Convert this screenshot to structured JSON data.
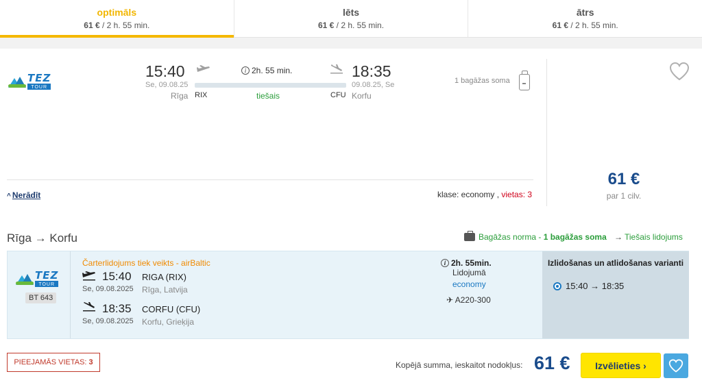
{
  "tabs": [
    {
      "title": "optimāls",
      "price": "61 €",
      "duration": " / 2 h. 55 min.",
      "active": true
    },
    {
      "title": "lēts",
      "price": "61 €",
      "duration": " / 2 h. 55 min.",
      "active": false
    },
    {
      "title": "ātrs",
      "price": "61 €",
      "duration": " / 2 h. 55 min.",
      "active": false
    }
  ],
  "summary": {
    "airline_logo": {
      "line1": "TEZ",
      "line2": "TOUR"
    },
    "depart_time": "15:40",
    "depart_date": "Se, 09.08.25",
    "depart_city": "Rīga",
    "depart_code": "RIX",
    "duration": "2h. 55 min.",
    "direct": "tiešais",
    "arrive_time": "18:35",
    "arrive_date": "09.08.25, Se",
    "arrive_city": "Korfu",
    "arrive_code": "CFU",
    "baggage": "1 bagāžas soma",
    "toggle_label": "Nerādīt",
    "class_label": "klase: economy , ",
    "seats_label": "vietas: 3",
    "price": "61 €",
    "per_person": "par 1 cilv."
  },
  "route": {
    "title": "Rīga → Korfu",
    "baggage_prefix": "Bagāžas norma - ",
    "baggage_value": "1 bagāžas soma",
    "direct_note": "Tiešais lidojums",
    "direct_arrow": "→"
  },
  "detail": {
    "flight_no": "BT 643",
    "charter": "Čarterlidojums tiek veikts - airBaltic",
    "dep_time": "15:40",
    "dep_airport": "RIGA (RIX)",
    "dep_date": "Se, 09.08.2025",
    "dep_location": "Rīga, Latvija",
    "arr_time": "18:35",
    "arr_airport": "CORFU (CFU)",
    "arr_date": "Se, 09.08.2025",
    "arr_location": "Korfu, Grieķija",
    "duration": "2h. 55min.",
    "flight_label": "Lidojumā",
    "cabin": "economy",
    "aircraft": "✈ A220-300",
    "variants_title": "Izlidošanas un atlidošanas varianti",
    "variant_option": "15:40 → 18:35"
  },
  "footer": {
    "seats_prefix": "PIEEJAMĀS VIETAS: ",
    "seats_count": "3",
    "total_label": "Kopējā summa, ieskaitot nodokļus:",
    "total_price": "61 €",
    "choose_label": "Izvēlieties ›"
  },
  "colors": {
    "accent_yellow": "#ffe500",
    "active_tab": "#f2b600",
    "price_blue": "#1a4c8c",
    "green": "#2a9d3a",
    "red": "#d0021b",
    "orange": "#f08a00"
  },
  "icons": [
    "takeoff-icon",
    "landing-icon",
    "info-icon",
    "bag-icon",
    "heart-icon",
    "suitcase-icon",
    "radio-icon"
  ]
}
